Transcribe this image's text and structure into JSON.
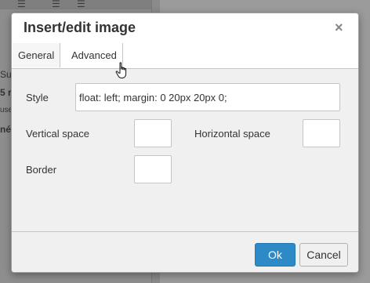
{
  "dialog": {
    "title": "Insert/edit image",
    "close_glyph": "×",
    "tabs": [
      {
        "label": "General",
        "active": false
      },
      {
        "label": "Advanced",
        "active": true
      }
    ],
    "fields": {
      "style": {
        "label": "Style",
        "value": "float: left; margin: 0 20px 20px 0;"
      },
      "vertical_space": {
        "label": "Vertical space",
        "value": ""
      },
      "horizontal_space": {
        "label": "Horizontal space",
        "value": ""
      },
      "border": {
        "label": "Border",
        "value": ""
      }
    },
    "buttons": {
      "ok": "Ok",
      "cancel": "Cancel"
    },
    "accent_color": "#2d8ac7"
  },
  "background": {
    "fragments": [
      "Su",
      "5 r",
      "use",
      "né"
    ],
    "icons": [
      "list-icon",
      "outdent-icon",
      "indent-icon"
    ]
  }
}
